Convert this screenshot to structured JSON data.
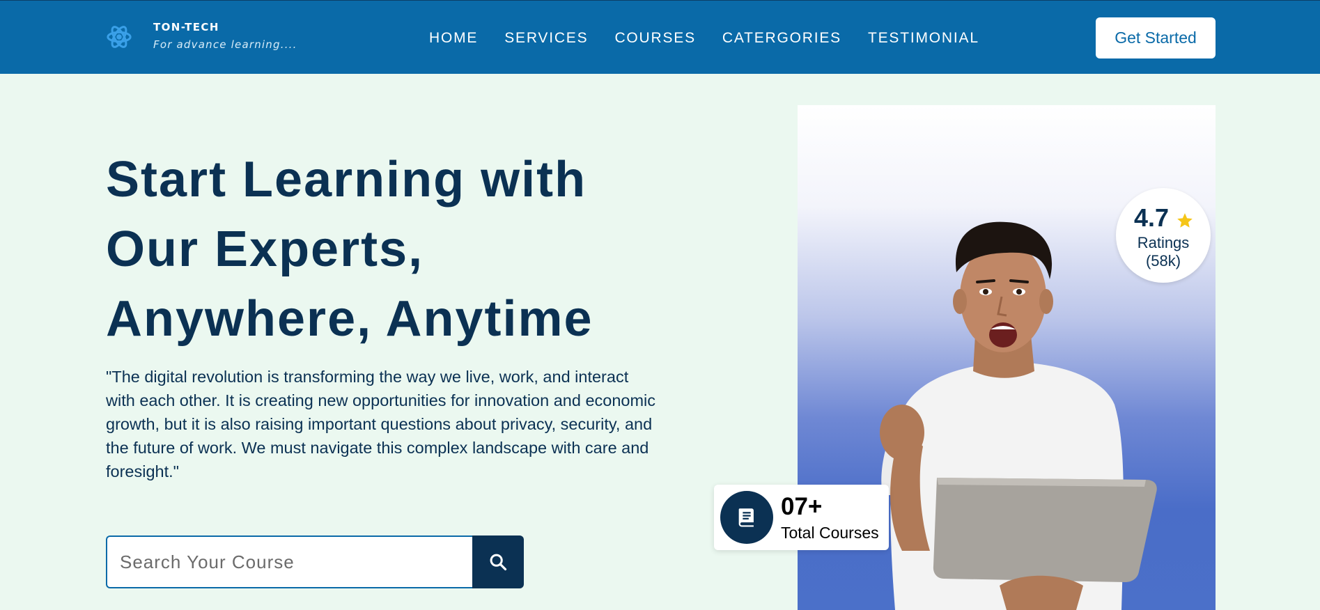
{
  "header": {
    "brand_name": "TON-TECH",
    "brand_tagline": "For advance learning....",
    "logo_icon": "atom-icon",
    "nav": [
      {
        "label": "HOME"
      },
      {
        "label": "SERVICES"
      },
      {
        "label": "COURSES"
      },
      {
        "label": "CATERGORIES"
      },
      {
        "label": "TESTIMONIAL"
      }
    ],
    "cta_label": "Get Started"
  },
  "hero": {
    "title_lines": [
      "Start Learning with",
      "Our Experts,",
      "Anywhere, Anytime"
    ],
    "quote": "\"The digital revolution is transforming the way we live, work, and interact with each other. It is creating new opportunities for innovation and economic growth, but it is also raising important questions about privacy, security, and the future of work. We must navigate this complex landscape with care and foresight.\"",
    "search": {
      "placeholder": "Search Your Course",
      "icon": "search-icon"
    }
  },
  "rating": {
    "value": "4.7",
    "icon": "star-icon",
    "label": "Ratings",
    "count": "(58k)"
  },
  "courses": {
    "count": "07+",
    "label": "Total Courses",
    "icon": "book-icon"
  },
  "colors": {
    "primary": "#0a6aa8",
    "dark": "#0b3153",
    "background": "#ebf8f0",
    "star": "#f5c518"
  }
}
